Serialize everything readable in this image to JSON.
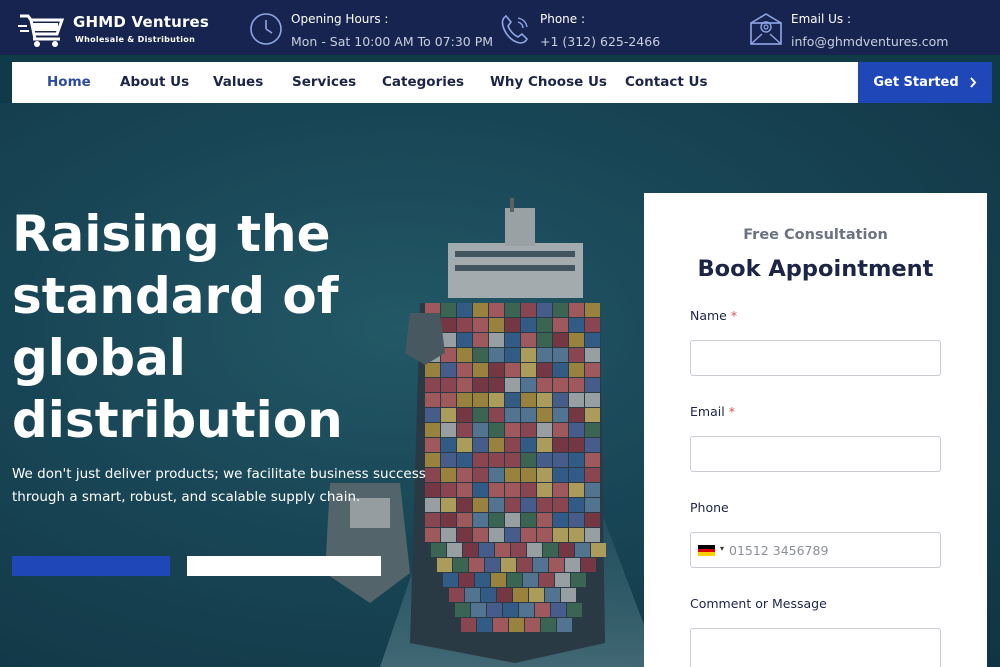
{
  "brand": {
    "name": "GHMD Ventures",
    "tagline": "Wholesale & Distribution"
  },
  "topbar": {
    "hours": {
      "label": "Opening Hours :",
      "value": "Mon - Sat 10:00 AM To 07:30 PM",
      "icon": "clock-icon"
    },
    "phone": {
      "label": "Phone :",
      "value": "+1 (312) 625-2466",
      "icon": "phone-icon"
    },
    "email": {
      "label": "Email Us :",
      "value": "info@ghmdventures.com",
      "icon": "envelope-icon"
    }
  },
  "nav": {
    "items": [
      "Home",
      "About Us",
      "Values",
      "Services",
      "Categories",
      "Why Choose Us",
      "Contact Us"
    ],
    "active": "Home",
    "cta": "Get Started",
    "cta_icon": "chevron-right-icon"
  },
  "hero": {
    "title": "Raising the standard of global distribution",
    "description": "We don't just deliver products; we facilitate business success through a smart, robust, and scalable supply chain."
  },
  "form": {
    "kicker": "Free Consultation",
    "title": "Book Appointment",
    "name_label": "Name",
    "email_label": "Email",
    "phone_label": "Phone",
    "phone_placeholder": "01512 3456789",
    "message_label": "Comment or Message",
    "required_mark": "*",
    "flag_arrow": "▾"
  },
  "colors": {
    "topbar_bg": "#17244f",
    "accent_blue": "#1f47b8",
    "text_dark": "#1c2547",
    "required_red": "#d9534f"
  }
}
